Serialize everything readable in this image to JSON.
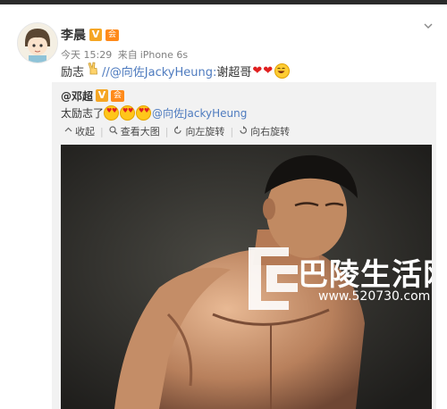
{
  "user": {
    "name": "李晨",
    "vip_badge": "V",
    "member_badge": "会"
  },
  "meta": {
    "time": "今天 15:29",
    "source_prefix": "来自",
    "source": "iPhone 6s"
  },
  "post": {
    "text_start": "励志",
    "mention": "//@向佐JackyHeung:",
    "text_after": "谢超哥",
    "heart_1": "❤",
    "heart_2": "❤"
  },
  "repost": {
    "user": "@邓超",
    "vip_badge": "V",
    "member_badge": "会",
    "text": "太励志了",
    "mention": "@向佐JackyHeung"
  },
  "toolbar": {
    "collapse": "收起",
    "view_large": "查看大图",
    "rotate_left": "向左旋转",
    "rotate_right": "向右旋转"
  },
  "watermark": {
    "brand": "巴陵生活网",
    "url": "www.520730.com"
  },
  "icons": {
    "close": "close-icon",
    "collapse": "collapse-icon",
    "zoom": "magnifier-icon",
    "rotate_left": "rotate-left-icon",
    "rotate_right": "rotate-right-icon"
  },
  "colors": {
    "mention": "#4e7bbf",
    "vip": "#f5a623",
    "repost_bg": "#f2f2f2"
  }
}
